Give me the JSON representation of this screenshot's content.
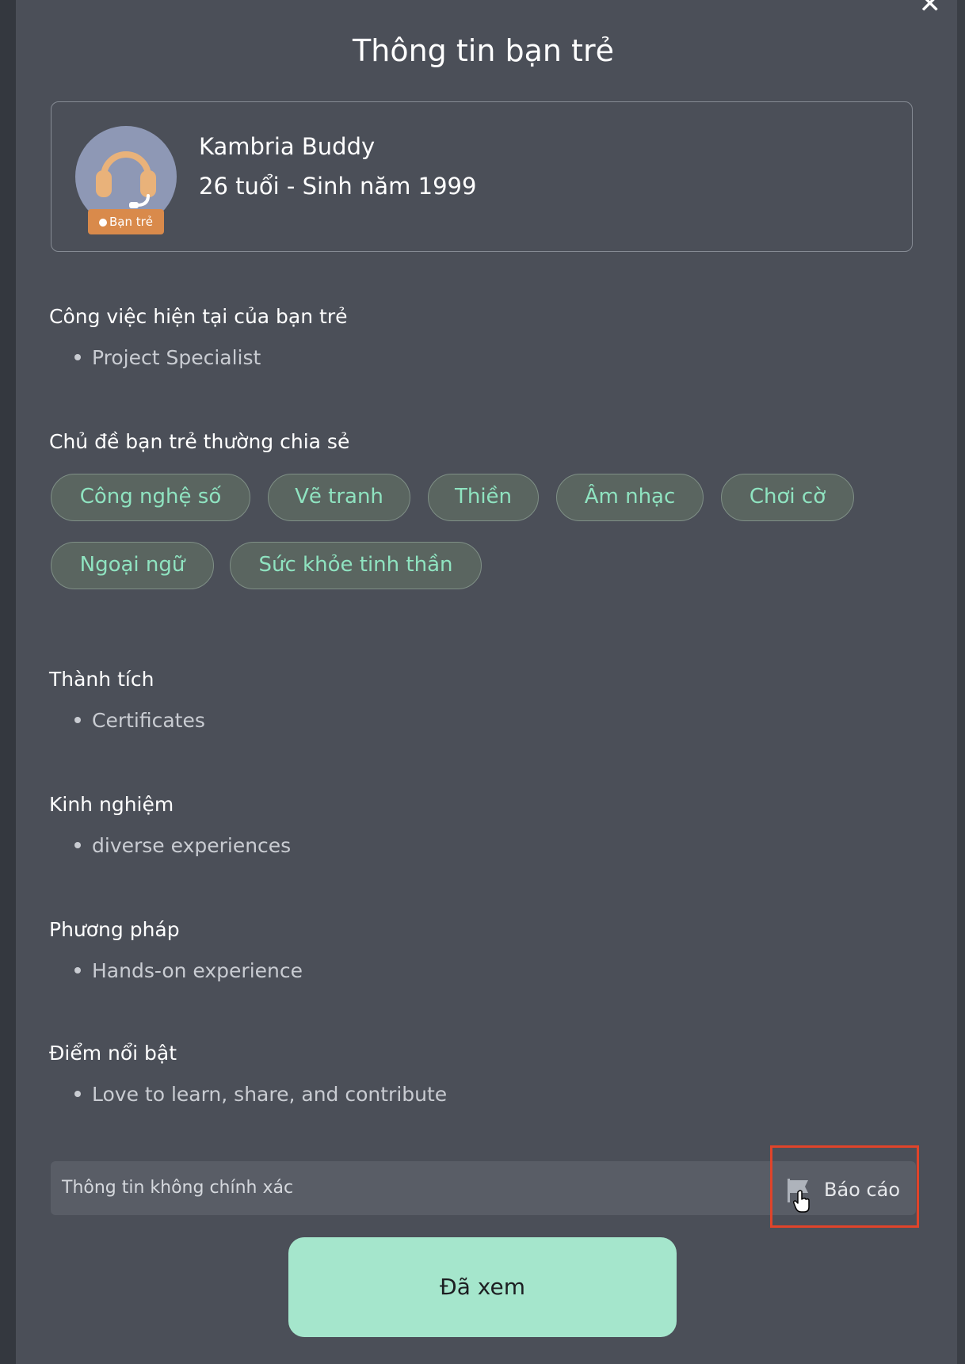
{
  "modal": {
    "title": "Thông tin bạn trẻ",
    "close_icon": "close-icon"
  },
  "profile": {
    "name": "Kambria Buddy",
    "age_line": "26 tuổi - Sinh năm 1999",
    "badge": "Bạn trẻ",
    "avatar_icon": "headset-icon"
  },
  "sections": {
    "job": {
      "heading": "Công việc hiện tại của bạn trẻ",
      "items": [
        "Project Specialist"
      ]
    },
    "topics": {
      "heading": "Chủ đề bạn trẻ thường chia sẻ",
      "tags": [
        "Công nghệ số",
        "Vẽ tranh",
        "Thiền",
        "Âm nhạc",
        "Chơi cờ",
        "Ngoại ngữ",
        "Sức khỏe tinh thần"
      ]
    },
    "achievements": {
      "heading": "Thành tích",
      "items": [
        "Certificates"
      ]
    },
    "experience": {
      "heading": "Kinh nghiệm",
      "items": [
        "diverse experiences"
      ]
    },
    "method": {
      "heading": "Phương pháp",
      "items": [
        "Hands-on experience"
      ]
    },
    "highlights": {
      "heading": "Điểm nổi bật",
      "items": [
        "Love to learn, share, and contribute"
      ]
    }
  },
  "report": {
    "text": "Thông tin không chính xác",
    "button_label": "Báo cáo",
    "icon": "flag-icon"
  },
  "actions": {
    "seen_label": "Đã xem"
  },
  "colors": {
    "modal_bg": "#4b4f58",
    "tag_text": "#8fe3c0",
    "primary_button": "#a5e6cc",
    "badge": "#d98a4b",
    "highlight_border": "#e0442a"
  }
}
